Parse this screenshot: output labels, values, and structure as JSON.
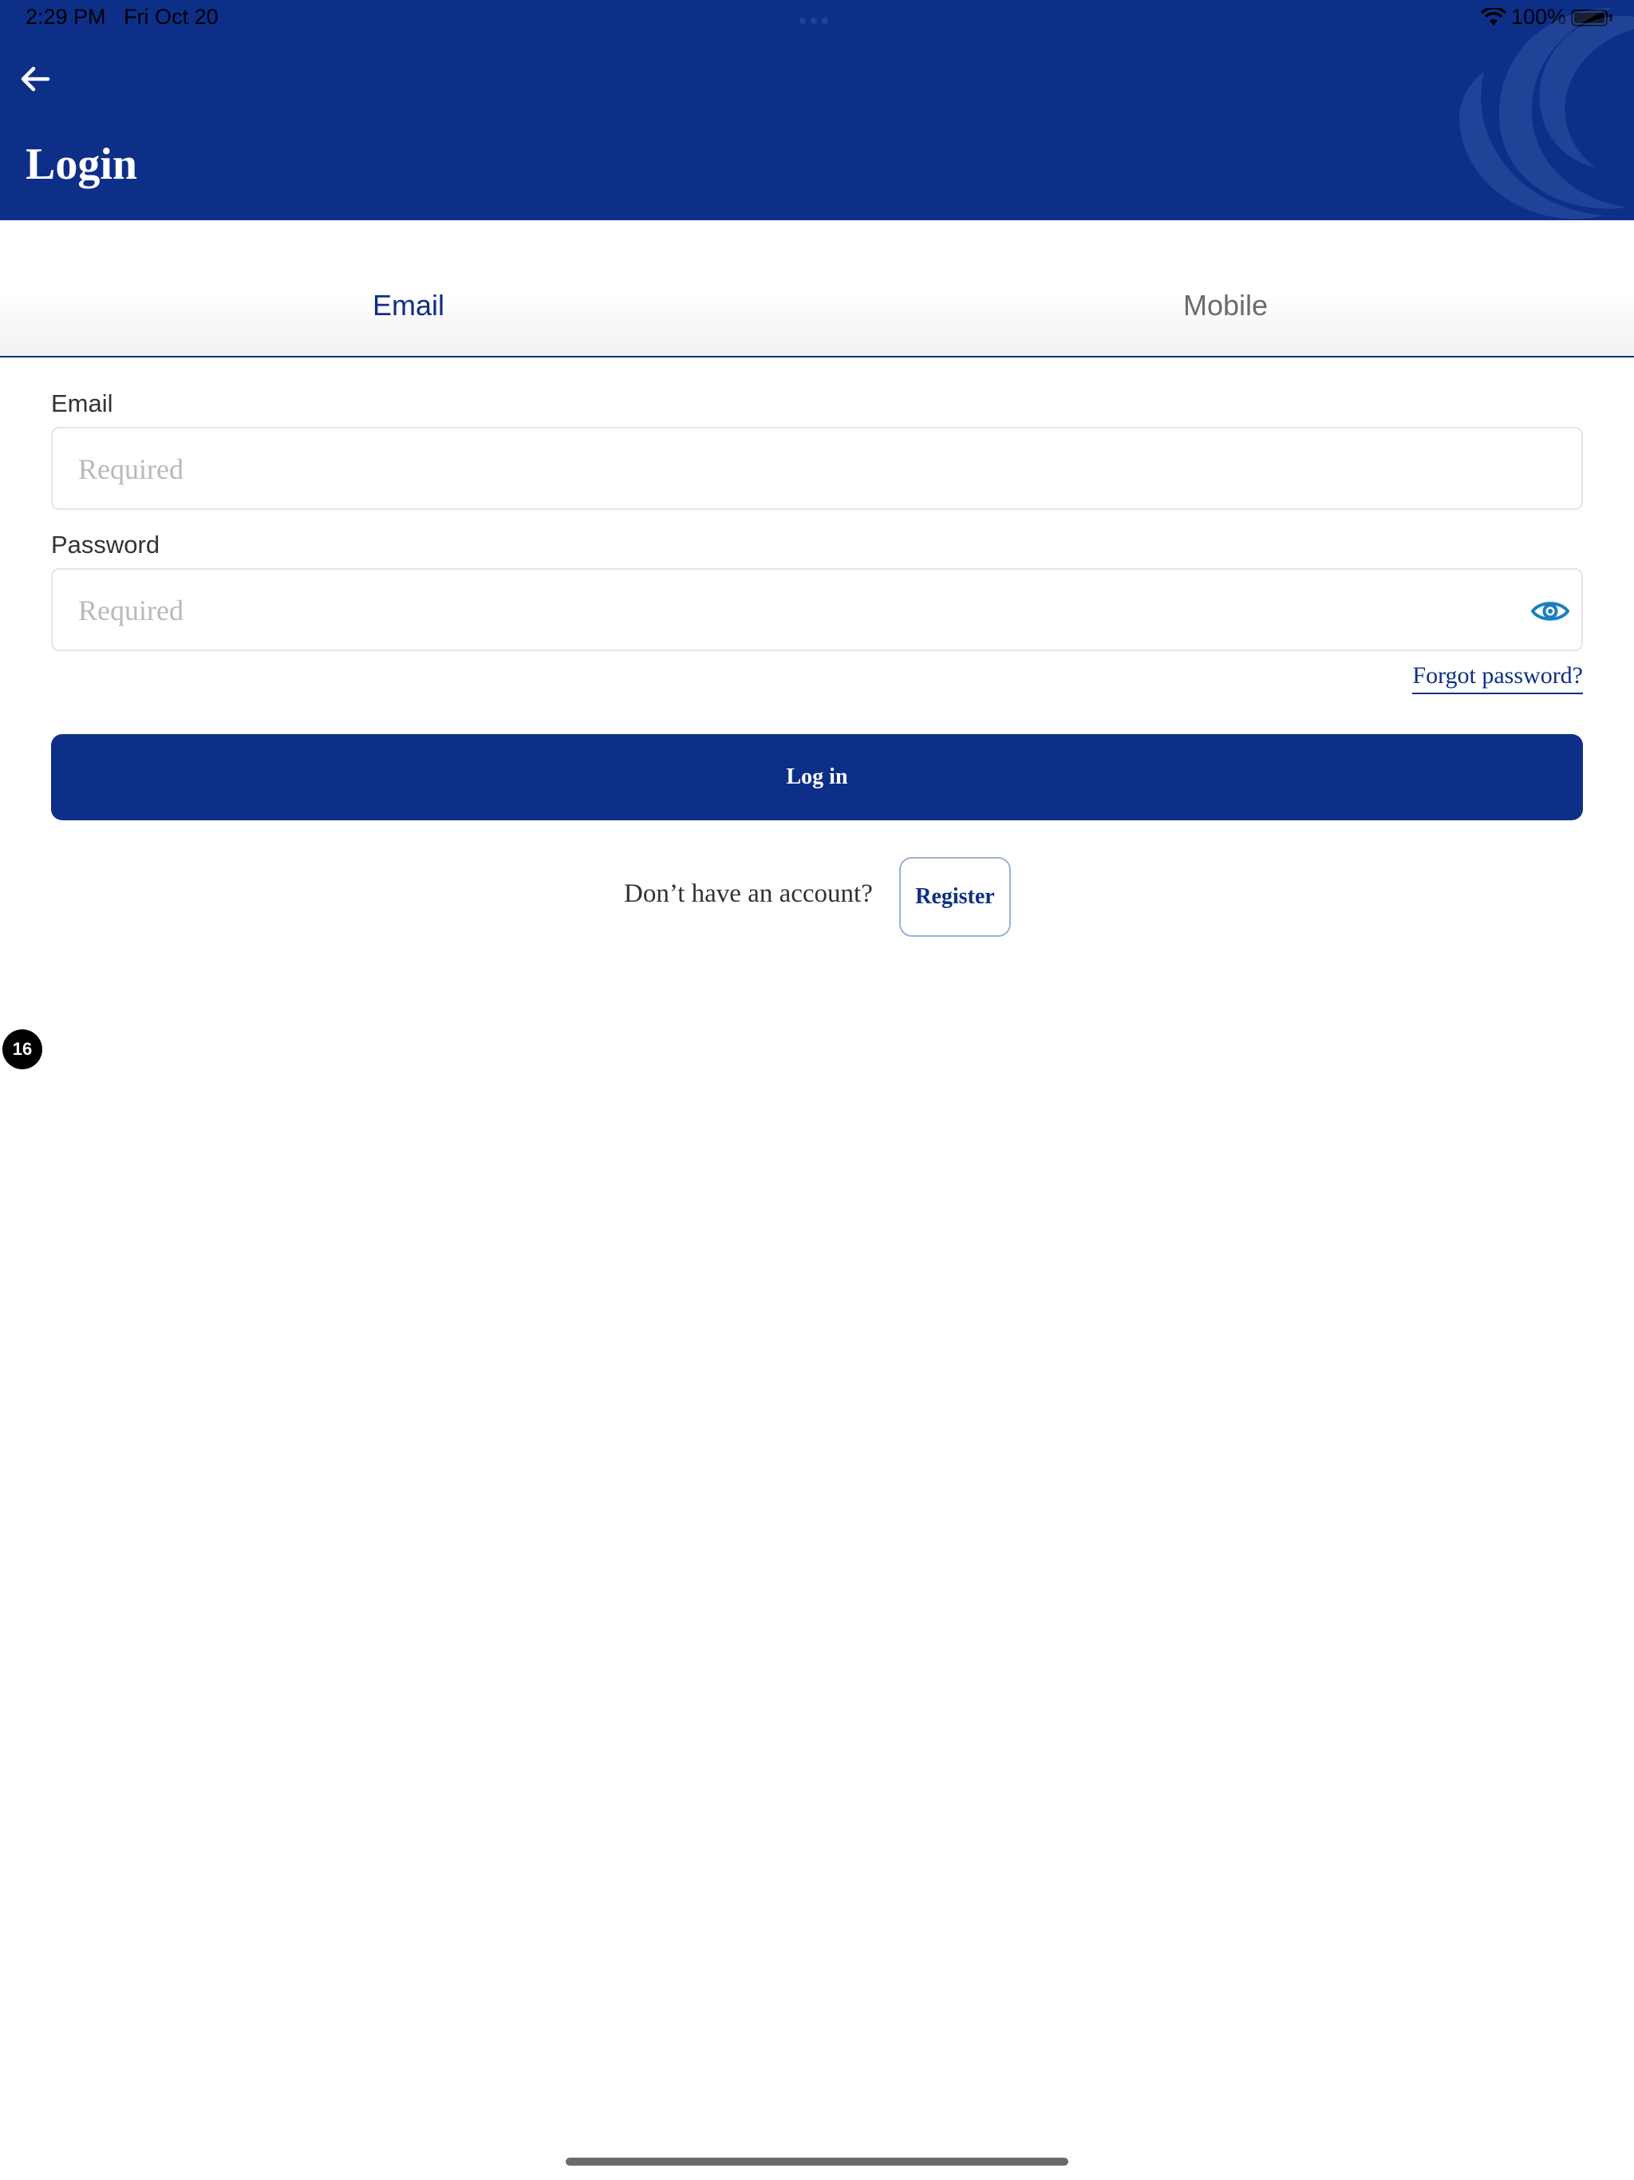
{
  "status_bar": {
    "time": "2:29 PM",
    "date": "Fri Oct 20",
    "battery": "100%",
    "icons": [
      "wifi-icon",
      "battery-icon",
      "multitasking-dots-icon"
    ]
  },
  "header": {
    "title": "Login",
    "back_icon": "arrow-left-icon",
    "background_color": "#0d2f87"
  },
  "tabs": [
    {
      "label": "Email",
      "active": true
    },
    {
      "label": "Mobile",
      "active": false
    }
  ],
  "form": {
    "email": {
      "label": "Email",
      "placeholder": "Required",
      "value": ""
    },
    "password": {
      "label": "Password",
      "placeholder": "Required",
      "value": "",
      "toggle_icon": "eye-icon"
    },
    "forgot_password": "Forgot password?",
    "login_label": "Log in"
  },
  "register": {
    "prompt": "Don’t have an account?",
    "button_label": "Register"
  },
  "badge": {
    "count": "16"
  },
  "colors": {
    "primary": "#0d2f87",
    "accent_icon": "#1a7fc1",
    "placeholder": "#b9b9b9"
  }
}
